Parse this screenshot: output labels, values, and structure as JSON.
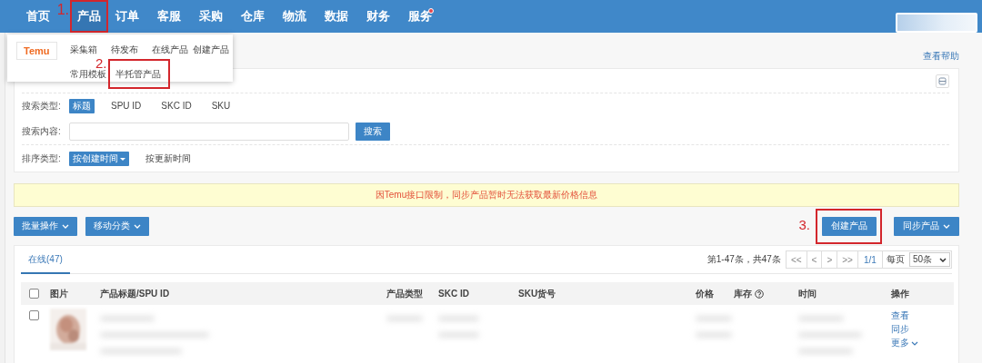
{
  "nav": [
    {
      "label": "首页",
      "selected": false,
      "badge": false
    },
    {
      "label": "产品",
      "selected": true,
      "badge": false,
      "annotation": "1."
    },
    {
      "label": "订单",
      "selected": false,
      "badge": false
    },
    {
      "label": "客服",
      "selected": false,
      "badge": false
    },
    {
      "label": "采购",
      "selected": false,
      "badge": false
    },
    {
      "label": "仓库",
      "selected": false,
      "badge": false
    },
    {
      "label": "物流",
      "selected": false,
      "badge": false
    },
    {
      "label": "数据",
      "selected": false,
      "badge": false
    },
    {
      "label": "财务",
      "selected": false,
      "badge": false
    },
    {
      "label": "服务",
      "selected": false,
      "badge": true
    }
  ],
  "menu": {
    "platform": "Temu",
    "rows": [
      [
        {
          "label": "采集箱"
        },
        {
          "label": "待发布"
        },
        {
          "label": "在线产品"
        },
        {
          "label": "创建产品"
        }
      ],
      [
        {
          "label": "常用模板"
        },
        {
          "label": "半托管产品",
          "annotation": "2."
        }
      ]
    ]
  },
  "help_link": "查看帮助",
  "filters": {
    "search_type": {
      "label": "搜索类型:",
      "options": [
        {
          "label": "标题",
          "selected": true
        },
        {
          "label": "SPU ID",
          "selected": false
        },
        {
          "label": "SKC ID",
          "selected": false
        },
        {
          "label": "SKU",
          "selected": false
        }
      ]
    },
    "search_content": {
      "label": "搜索内容:",
      "button": "搜索"
    },
    "sort_type": {
      "label": "排序类型:",
      "options": [
        {
          "label": "按创建时间",
          "selected": true
        },
        {
          "label": "按更新时间",
          "selected": false
        }
      ]
    }
  },
  "notice": "因Temu接口限制，同步产品暂时无法获取最新价格信息",
  "left_buttons": [
    {
      "label": "批量操作"
    },
    {
      "label": "移动分类"
    }
  ],
  "right_buttons": [
    {
      "label": "创建产品",
      "dropdown": false,
      "annotation": "3."
    },
    {
      "label": "同步产品",
      "dropdown": true
    }
  ],
  "tabs": [
    {
      "label": "在线(47)",
      "selected": true
    }
  ],
  "pagination": {
    "summary": "第1-47条，共47条",
    "buttons": [
      "<<",
      "<",
      ">",
      ">>"
    ],
    "page": "1/1",
    "per_page_label": "每页",
    "per_page": "50条"
  },
  "table": {
    "all_checked": false,
    "columns": [
      {
        "label": "图片",
        "help": false
      },
      {
        "label": "产品标题/SPU ID",
        "help": false
      },
      {
        "label": "产品类型",
        "help": false
      },
      {
        "label": "SKC ID",
        "help": false
      },
      {
        "label": "SKU货号",
        "help": false
      },
      {
        "label": "价格",
        "help": false
      },
      {
        "label": "库存",
        "help": true
      },
      {
        "label": "时间",
        "help": false
      },
      {
        "label": "操作",
        "help": false
      }
    ],
    "rows": [
      {
        "checked": false,
        "image": {
          "kind": "picture"
        },
        "actions": [
          {
            "label": "查看",
            "dropdown": false
          },
          {
            "label": "同步",
            "dropdown": false
          },
          {
            "label": "更多",
            "dropdown": true
          }
        ]
      }
    ]
  }
}
